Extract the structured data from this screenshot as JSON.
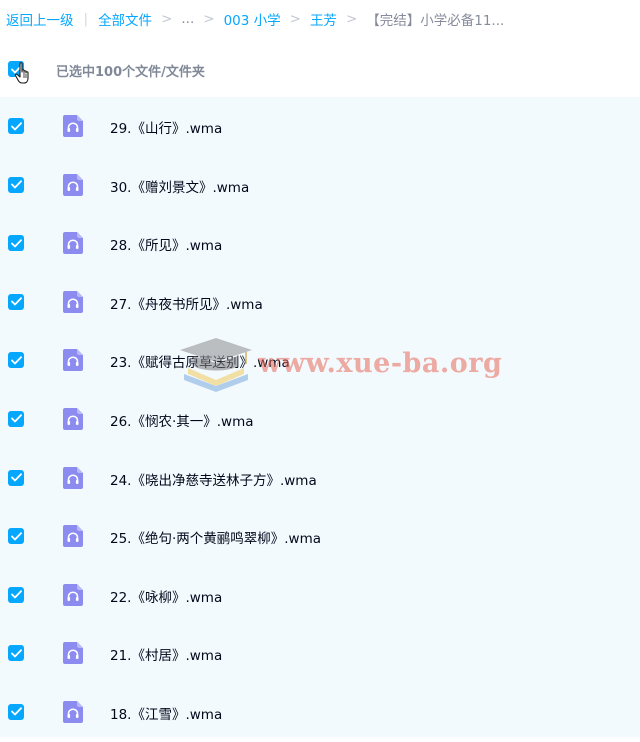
{
  "breadcrumb": {
    "back": "返回上一级",
    "separator_bar": "|",
    "items": [
      "全部文件",
      "...",
      "003 小学",
      "王芳"
    ],
    "separator": ">",
    "current": "【完结】小学必备11..."
  },
  "selection": {
    "text": "已选中100个文件/文件夹",
    "checked": true
  },
  "files": [
    {
      "name": "29.《山行》.wma",
      "checked": true,
      "icon": "audio-file-icon"
    },
    {
      "name": "30.《赠刘景文》.wma",
      "checked": true,
      "icon": "audio-file-icon"
    },
    {
      "name": "28.《所见》.wma",
      "checked": true,
      "icon": "audio-file-icon"
    },
    {
      "name": "27.《舟夜书所见》.wma",
      "checked": true,
      "icon": "audio-file-icon"
    },
    {
      "name": "23.《赋得古原草送别》.wma",
      "checked": true,
      "icon": "audio-file-icon"
    },
    {
      "name": "26.《悯农·其一》.wma",
      "checked": true,
      "icon": "audio-file-icon"
    },
    {
      "name": "24.《晓出净慈寺送林子方》.wma",
      "checked": true,
      "icon": "audio-file-icon"
    },
    {
      "name": "25.《绝句·两个黄鹂鸣翠柳》.wma",
      "checked": true,
      "icon": "audio-file-icon"
    },
    {
      "name": "22.《咏柳》.wma",
      "checked": true,
      "icon": "audio-file-icon"
    },
    {
      "name": "21.《村居》.wma",
      "checked": true,
      "icon": "audio-file-icon"
    },
    {
      "name": "18.《江雪》.wma",
      "checked": true,
      "icon": "audio-file-icon"
    }
  ],
  "watermark": {
    "text": "www.xue-ba.org"
  },
  "colors": {
    "accent": "#06a7ff",
    "list_background": "#f3fafe",
    "file_icon": "#8c8cf0",
    "watermark": "#e76758"
  }
}
